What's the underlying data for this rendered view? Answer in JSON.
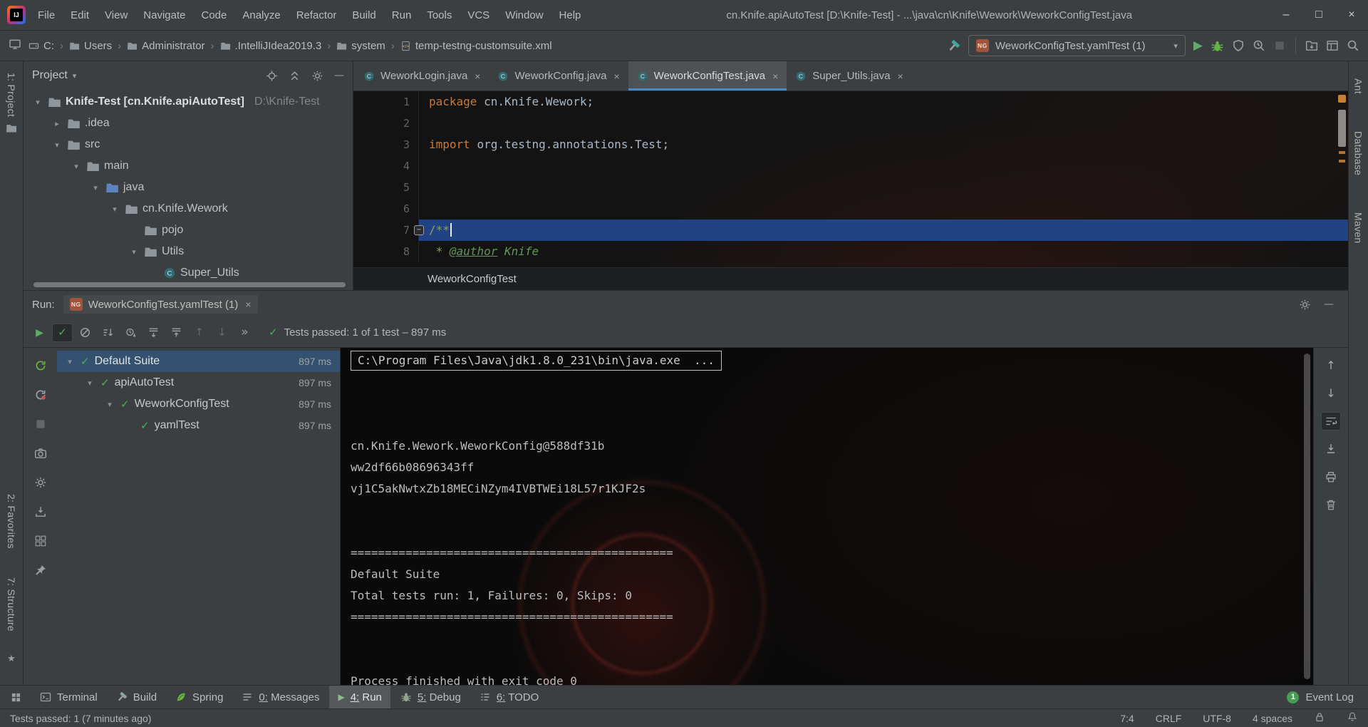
{
  "window": {
    "title": "cn.Knife.apiAutoTest [D:\\Knife-Test] - ...\\java\\cn\\Knife\\Wework\\WeworkConfigTest.java",
    "menus": [
      "File",
      "Edit",
      "View",
      "Navigate",
      "Code",
      "Analyze",
      "Refactor",
      "Build",
      "Run",
      "Tools",
      "VCS",
      "Window",
      "Help"
    ]
  },
  "navbar": {
    "breadcrumbs": [
      {
        "label": "C:",
        "icon": "drive"
      },
      {
        "label": "Users",
        "icon": "folder"
      },
      {
        "label": "Administrator",
        "icon": "folder"
      },
      {
        "label": ".IntelliJIdea2019.3",
        "icon": "folder"
      },
      {
        "label": "system",
        "icon": "folder"
      },
      {
        "label": "temp-testng-customsuite.xml",
        "icon": "xml-file"
      }
    ],
    "run_config": "WeworkConfigTest.yamlTest (1)"
  },
  "stripes": {
    "left_top": [
      "1: Project"
    ],
    "left_bottom": [
      "2: Favorites",
      "7: Structure"
    ],
    "right": [
      "Ant",
      "Database",
      "Maven"
    ]
  },
  "project_panel": {
    "title": "Project",
    "root": {
      "name": "Knife-Test [cn.Knife.apiAutoTest]",
      "path": "D:\\Knife-Test"
    },
    "items": [
      {
        "label": ".idea",
        "depth": 1,
        "icon": "folder",
        "arrow": "collapsed"
      },
      {
        "label": "src",
        "depth": 1,
        "icon": "folder",
        "arrow": "expanded"
      },
      {
        "label": "main",
        "depth": 2,
        "icon": "folder",
        "arrow": "expanded"
      },
      {
        "label": "java",
        "depth": 3,
        "icon": "folder-src",
        "arrow": "expanded"
      },
      {
        "label": "cn.Knife.Wework",
        "depth": 4,
        "icon": "package",
        "arrow": "expanded"
      },
      {
        "label": "pojo",
        "depth": 5,
        "icon": "package",
        "arrow": "none"
      },
      {
        "label": "Utils",
        "depth": 5,
        "icon": "package",
        "arrow": "expanded"
      },
      {
        "label": "Super_Utils",
        "depth": 6,
        "icon": "class",
        "arrow": "none"
      }
    ]
  },
  "editor": {
    "tabs": [
      {
        "label": "WeworkLogin.java",
        "active": false
      },
      {
        "label": "WeworkConfig.java",
        "active": false
      },
      {
        "label": "WeworkConfigTest.java",
        "active": true
      },
      {
        "label": "Super_Utils.java",
        "active": false
      }
    ],
    "breadcrumb": "WeworkConfigTest",
    "lines": [
      {
        "num": "1",
        "segments": [
          {
            "text": "package ",
            "style": "keyword"
          },
          {
            "text": "cn.Knife.Wework;",
            "style": "plain"
          }
        ]
      },
      {
        "num": "2",
        "segments": []
      },
      {
        "num": "3",
        "segments": [
          {
            "text": "import ",
            "style": "keyword"
          },
          {
            "text": "org.testng.annotations.Test;",
            "style": "plain"
          }
        ]
      },
      {
        "num": "4",
        "segments": []
      },
      {
        "num": "5",
        "segments": []
      },
      {
        "num": "6",
        "segments": []
      },
      {
        "num": "7",
        "segments": [
          {
            "text": "/**",
            "style": "comment"
          }
        ],
        "caret": true,
        "current": true,
        "fold": true
      },
      {
        "num": "8",
        "segments": [
          {
            "text": " * ",
            "style": "comment"
          },
          {
            "text": "@author",
            "style": "doc-tag"
          },
          {
            "text": " Knife",
            "style": "doc-value"
          }
        ]
      }
    ]
  },
  "run_panel": {
    "label": "Run:",
    "tab": "WeworkConfigTest.yamlTest (1)",
    "status": "Tests passed: 1 of 1 test – 897 ms",
    "tests": [
      {
        "label": "Default Suite",
        "time": "897 ms",
        "depth": 0,
        "selected": true,
        "arrow": true
      },
      {
        "label": "apiAutoTest",
        "time": "897 ms",
        "depth": 1,
        "selected": false,
        "arrow": true
      },
      {
        "label": "WeworkConfigTest",
        "time": "897 ms",
        "depth": 2,
        "selected": false,
        "arrow": true
      },
      {
        "label": "yamlTest",
        "time": "897 ms",
        "depth": 3,
        "selected": false,
        "arrow": false
      }
    ],
    "console": {
      "command": "C:\\Program Files\\Java\\jdk1.8.0_231\\bin\\java.exe  ...",
      "lines": [
        "",
        "",
        "",
        "cn.Knife.Wework.WeworkConfig@588df31b",
        "ww2df66b08696343ff",
        "vj1C5akNwtxZb18MECiNZym4IVBTWEi18L57r1KJF2s",
        "",
        "",
        "===============================================",
        "Default Suite",
        "Total tests run: 1, Failures: 0, Skips: 0",
        "===============================================",
        "",
        "",
        "Process finished with exit code 0"
      ]
    }
  },
  "bottom_bar": {
    "buttons": [
      {
        "label": "Terminal",
        "icon": "terminal",
        "active": false,
        "mnemonic": false
      },
      {
        "label": "Build",
        "icon": "build",
        "active": false,
        "mnemonic": false
      },
      {
        "label": "Spring",
        "icon": "spring",
        "active": false,
        "mnemonic": false
      },
      {
        "label": "0: Messages",
        "icon": "messages",
        "active": false,
        "mnemonic": true
      },
      {
        "label": "4: Run",
        "icon": "run",
        "active": true,
        "mnemonic": true
      },
      {
        "label": "5: Debug",
        "icon": "debug",
        "active": false,
        "mnemonic": true
      },
      {
        "label": "6: TODO",
        "icon": "todo",
        "active": false,
        "mnemonic": true
      }
    ],
    "event_log": {
      "badge": "1",
      "label": "Event Log"
    }
  },
  "status_bar": {
    "message": "Tests passed: 1 (7 minutes ago)",
    "caret": "7:4",
    "line_sep": "CRLF",
    "encoding": "UTF-8",
    "indent": "4 spaces"
  },
  "icons": {
    "testng": "NG",
    "chevron": "›",
    "caret_down": "▾",
    "expand": "▾",
    "collapse": "▸",
    "close": "×",
    "minimize": "–",
    "maximize": "□",
    "play": "▶",
    "more": "»",
    "up": "↑",
    "down": "↓",
    "check": "✓",
    "hide": "—",
    "star": "★",
    "fold_minus": "−"
  },
  "colors": {
    "panel_bg": "#3c3f41",
    "editor_bg": "#131313",
    "keyword_orange": "#cc7832",
    "doc_green": "#629755",
    "caret_line_blue": "#214283",
    "tree_selection_blue": "#345170",
    "test_pass_green": "#4db05b",
    "active_tab_underline": "#4a88c7",
    "event_badge_green": "#499c54"
  }
}
